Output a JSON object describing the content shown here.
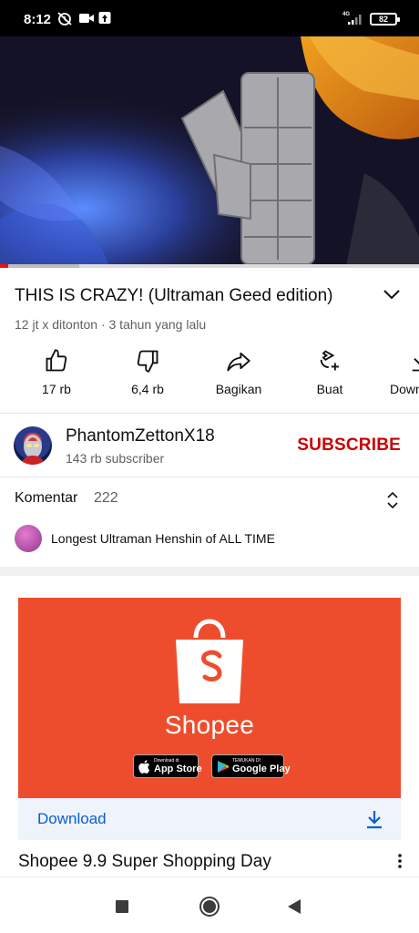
{
  "status_bar": {
    "time": "8:12",
    "battery": "82",
    "network": "4G",
    "icons": [
      "alarm-off-icon",
      "video-camera-icon",
      "upload-icon",
      "signal-icon",
      "battery-icon"
    ]
  },
  "video": {
    "title": "THIS IS CRAZY! (Ultraman Geed edition)",
    "meta": "12 jt x ditonton · 3 tahun yang lalu",
    "progress_played": 0.02,
    "progress_loaded": 0.19
  },
  "actions": [
    {
      "label": "17 rb",
      "icon": "thumbs-up-icon"
    },
    {
      "label": "6,4 rb",
      "icon": "thumbs-down-icon"
    },
    {
      "label": "Bagikan",
      "icon": "share-icon"
    },
    {
      "label": "Buat",
      "icon": "remix-icon"
    },
    {
      "label": "Download",
      "icon": "download-icon"
    }
  ],
  "channel": {
    "name": "PhantomZettonX18",
    "subscribers": "143 rb subscriber",
    "subscribe_label": "SUBSCRIBE"
  },
  "comments": {
    "label": "Komentar",
    "count": "222",
    "top_comment": "Longest Ultraman Henshin of ALL TIME"
  },
  "ad": {
    "brand": "Shopee",
    "app_store_small": "Download di",
    "app_store_big": "App Store",
    "play_store_small": "TEMUKAN DI",
    "play_store_big": "Google Play",
    "download_label": "Download",
    "title": "Shopee 9.9 Super Shopping Day"
  },
  "colors": {
    "subscribe": "#cc0000",
    "link_blue": "#065fd4",
    "shopee_orange": "#ee4d2d",
    "progress_red": "#ee1111"
  }
}
